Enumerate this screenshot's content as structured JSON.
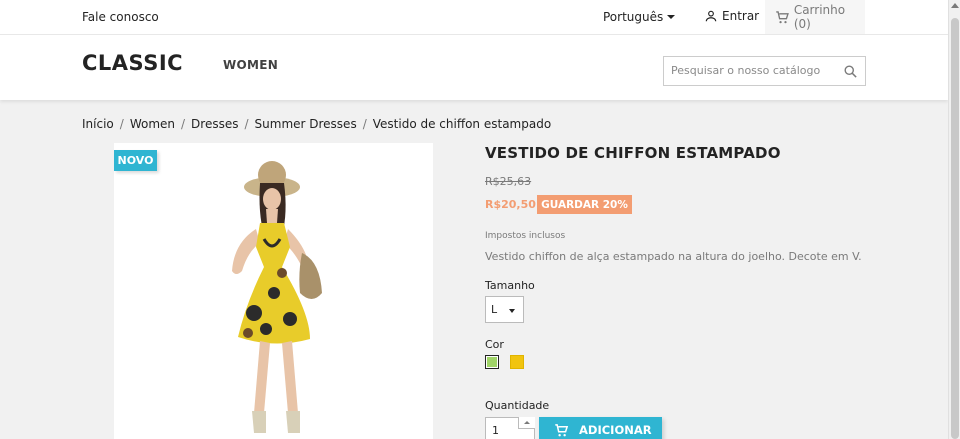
{
  "topbar": {
    "contact": "Fale conosco",
    "language": "Português",
    "login": "Entrar",
    "cart": "Carrinho (0)"
  },
  "header": {
    "logo": "CLASSIC",
    "nav": [
      "WOMEN"
    ],
    "search_placeholder": "Pesquisar o nosso catálogo"
  },
  "breadcrumb": [
    "Início",
    "Women",
    "Dresses",
    "Summer Dresses",
    "Vestido de chiffon estampado"
  ],
  "product": {
    "badge": "NOVO",
    "title": "VESTIDO DE CHIFFON ESTAMPADO",
    "old_price": "R$25,63",
    "price": "R$20,50",
    "discount": "GUARDAR 20%",
    "tax_note": "Impostos inclusos",
    "description": "Vestido chiffon de alça estampado na altura do joelho. Decote em V.",
    "size_label": "Tamanho",
    "size_value": "L",
    "color_label": "Cor",
    "colors": [
      "#a0d468",
      "#f1c40f"
    ],
    "quantity_label": "Quantidade",
    "quantity": "1",
    "add_button": "ADICIONAR"
  },
  "colors": {
    "accent": "#2fb5d2",
    "discount": "#f39d72"
  }
}
